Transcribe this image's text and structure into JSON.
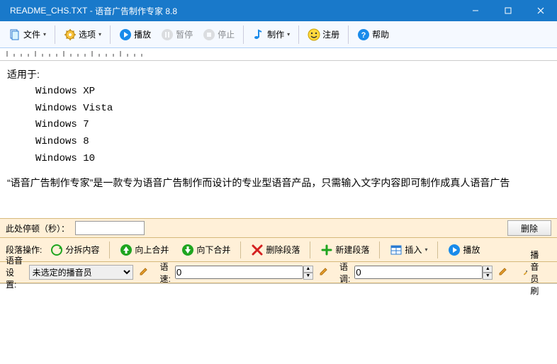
{
  "titlebar": {
    "filename": "README_CHS.TXT",
    "appname": "语音广告制作专家 8.8"
  },
  "toolbar": {
    "file": "文件",
    "options": "选项",
    "play": "播放",
    "pause": "暂停",
    "stop": "停止",
    "make": "制作",
    "register": "注册",
    "help": "帮助"
  },
  "editor": {
    "heading": "适用于:",
    "lines": [
      "Windows XP",
      "Windows Vista",
      "Windows 7",
      "Windows 8",
      "Windows 10"
    ],
    "paragraph": "“语音广告制作专家”是一款专为语音广告制作而设计的专业型语音产品，只需输入文字内容即可制作成真人语音广告"
  },
  "pause": {
    "label": "此处停顿（秒）：",
    "value": "",
    "delete": "删除"
  },
  "para_ops": {
    "label": "段落操作:",
    "split": "分拆内容",
    "merge_up": "向上合并",
    "merge_down": "向下合并",
    "delete_para": "删除段落",
    "new_para": "新建段落",
    "insert": "插入",
    "play": "播放"
  },
  "voice": {
    "label": "语音设置:",
    "announcer_placeholder": "未选定的播音员",
    "speed_label": "语速:",
    "speed_value": "0",
    "tone_label": "语调:",
    "tone_value": "0",
    "brush": "播音员刷"
  }
}
